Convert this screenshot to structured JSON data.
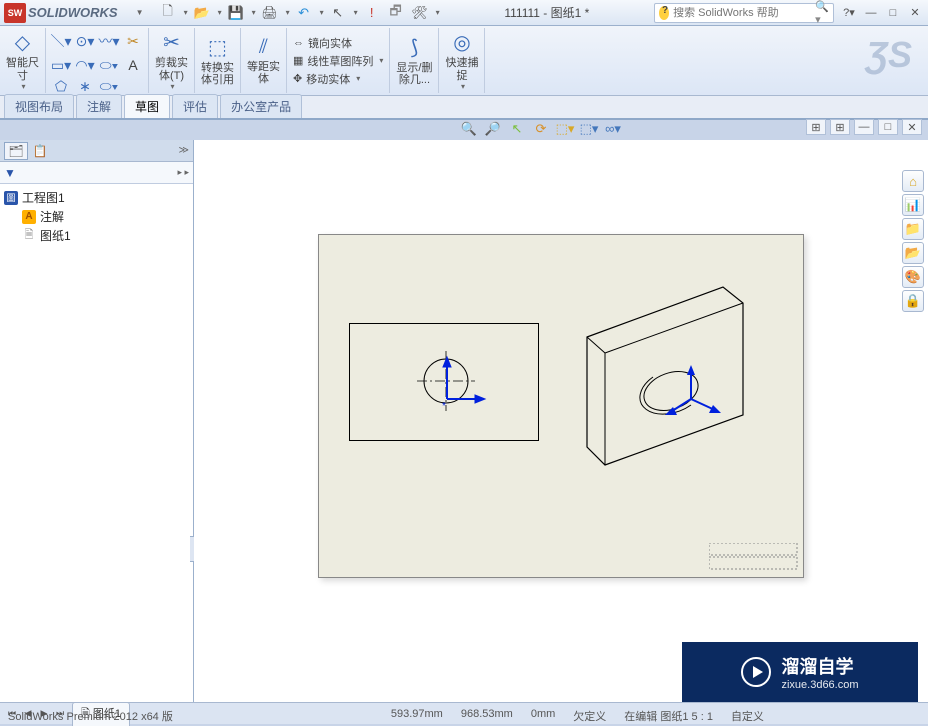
{
  "app": {
    "logo_text": "SW",
    "brand": "SOLIDWORKS",
    "doc_title": "111111 - 图纸1 *",
    "search_placeholder": "搜索 SolidWorks 帮助",
    "premium": "SolidWorks Premium 2012 x64 版"
  },
  "qat": {
    "new": "□",
    "open": "📂",
    "save": "💾",
    "print": "🖨",
    "undo": "↶",
    "select": "↖",
    "rebuild": "🚦",
    "options": "⚙",
    "help": "?"
  },
  "ribbon": {
    "smart_dim": "智能尺\n寸",
    "trim": "剪裁实\n体(T)",
    "convert": "转换实\n体引用",
    "offset": "等距实\n体",
    "mirror": "镜向实体",
    "linear_pattern": "线性草图阵列",
    "move": "移动实体",
    "show_hide": "显示/删\n除几...",
    "quick_snap": "快速捕\n捉"
  },
  "tabs": {
    "t1": "视图布局",
    "t2": "注解",
    "t3": "草图",
    "t4": "评估",
    "t5": "办公室产品"
  },
  "tree": {
    "root": "工程图1",
    "annotations": "注解",
    "sheet": "图纸1"
  },
  "sheet_tab": "图纸1",
  "status": {
    "x": "593.97mm",
    "y": "968.53mm",
    "z": "0mm",
    "under": "欠定义",
    "editing": "在编辑 图纸1  5 : 1",
    "custom": "自定义"
  },
  "watermark": {
    "zh": "溜溜自学",
    "url": "zixue.3d66.com"
  }
}
